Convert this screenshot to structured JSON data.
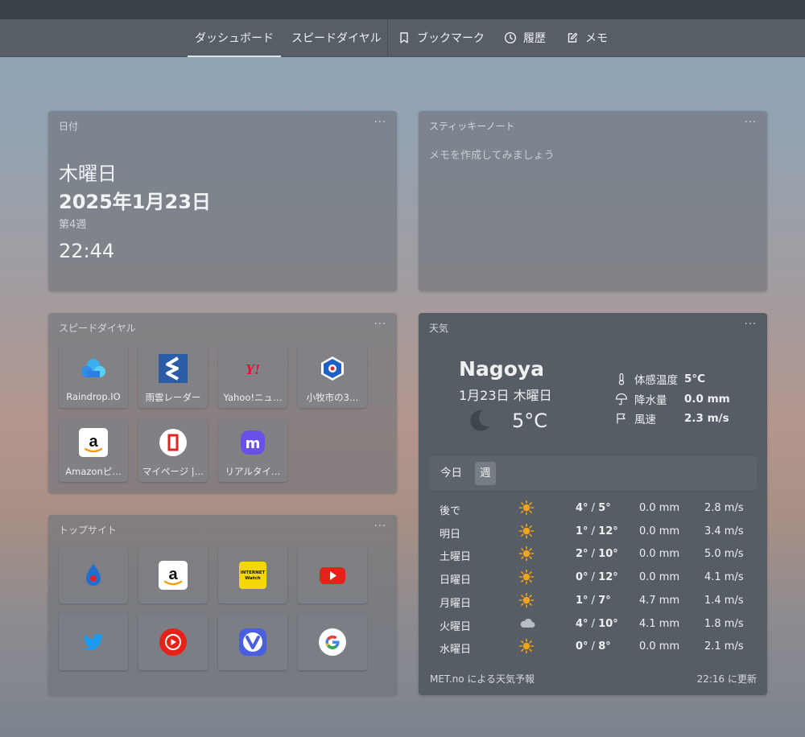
{
  "nav": {
    "tabs": [
      {
        "label": "ダッシュボード",
        "active": true
      },
      {
        "label": "スピードダイヤル",
        "active": false
      },
      {
        "label": "ブックマーク",
        "icon": "bookmark-icon"
      },
      {
        "label": "履歴",
        "icon": "clock-icon"
      },
      {
        "label": "メモ",
        "icon": "edit-note-icon"
      }
    ]
  },
  "date_card": {
    "title": "日付",
    "menu": "···",
    "day": "木曜日",
    "date": "2025年1月23日",
    "week": "第4週",
    "time": "22:44"
  },
  "note_card": {
    "title": "スティッキーノート",
    "menu": "···",
    "placeholder": "メモを作成してみましょう"
  },
  "speeddial_card": {
    "title": "スピードダイヤル",
    "menu": "···",
    "items": [
      {
        "label": "Raindrop.IO",
        "icon": "raindrop-icon"
      },
      {
        "label": "雨雲レーダー",
        "icon": "rain-radar-icon"
      },
      {
        "label": "Yahoo!ニュ…",
        "icon": "yahoo-icon"
      },
      {
        "label": "小牧市の3…",
        "icon": "komaki-icon"
      },
      {
        "label": "Amazonピ…",
        "icon": "amazon-icon"
      },
      {
        "label": "マイページ |…",
        "icon": "mypage-icon"
      },
      {
        "label": "リアルタイ…",
        "icon": "mastodon-icon"
      }
    ]
  },
  "topsites_card": {
    "title": "トップサイト",
    "menu": "···",
    "items": [
      {
        "icon": "site-blue-icon"
      },
      {
        "icon": "amazon-icon"
      },
      {
        "icon": "internet-watch-icon",
        "text": "INTERNET Watch"
      },
      {
        "icon": "youtube-icon"
      },
      {
        "icon": "twitter-icon"
      },
      {
        "icon": "youtube-music-icon"
      },
      {
        "icon": "vivaldi-icon"
      },
      {
        "icon": "google-icon"
      }
    ]
  },
  "weather_card": {
    "title": "天気",
    "menu": "···",
    "city": "Nagoya",
    "date": "1月23日 木曜日",
    "temp": "5°C",
    "stats": [
      {
        "label": "体感温度",
        "value": "5°C",
        "icon": "thermometer-icon"
      },
      {
        "label": "降水量",
        "value": "0.0 mm",
        "icon": "umbrella-icon"
      },
      {
        "label": "風速",
        "value": "2.3 m/s",
        "icon": "flag-icon"
      }
    ],
    "tabs": [
      {
        "label": "今日",
        "active": false
      },
      {
        "label": "週",
        "active": true
      }
    ],
    "forecast": [
      {
        "day": "後で",
        "icon": "sun-icon",
        "low": "4°",
        "high": "5°",
        "rain": "0.0 mm",
        "wind": "2.8 m/s"
      },
      {
        "day": "明日",
        "icon": "sun-icon",
        "low": "1°",
        "high": "12°",
        "rain": "0.0 mm",
        "wind": "3.4 m/s"
      },
      {
        "day": "土曜日",
        "icon": "sun-icon",
        "low": "2°",
        "high": "10°",
        "rain": "0.0 mm",
        "wind": "5.0 m/s"
      },
      {
        "day": "日曜日",
        "icon": "sun-icon",
        "low": "0°",
        "high": "12°",
        "rain": "0.0 mm",
        "wind": "4.1 m/s"
      },
      {
        "day": "月曜日",
        "icon": "sun-icon",
        "low": "1°",
        "high": "7°",
        "rain": "4.7 mm",
        "wind": "1.4 m/s"
      },
      {
        "day": "火曜日",
        "icon": "cloud-icon",
        "low": "4°",
        "high": "10°",
        "rain": "4.1 mm",
        "wind": "1.8 m/s"
      },
      {
        "day": "水曜日",
        "icon": "sun-icon",
        "low": "0°",
        "high": "8°",
        "rain": "0.0 mm",
        "wind": "2.1 m/s"
      }
    ],
    "source": "MET.no による天気予報",
    "updated": "22:16 に更新"
  },
  "colors": {
    "nav_bg": "#575e66",
    "card_dark": "#575d64",
    "sun": "#f2a21b",
    "youtube": "#e62117",
    "twitter": "#1d9bf0"
  }
}
